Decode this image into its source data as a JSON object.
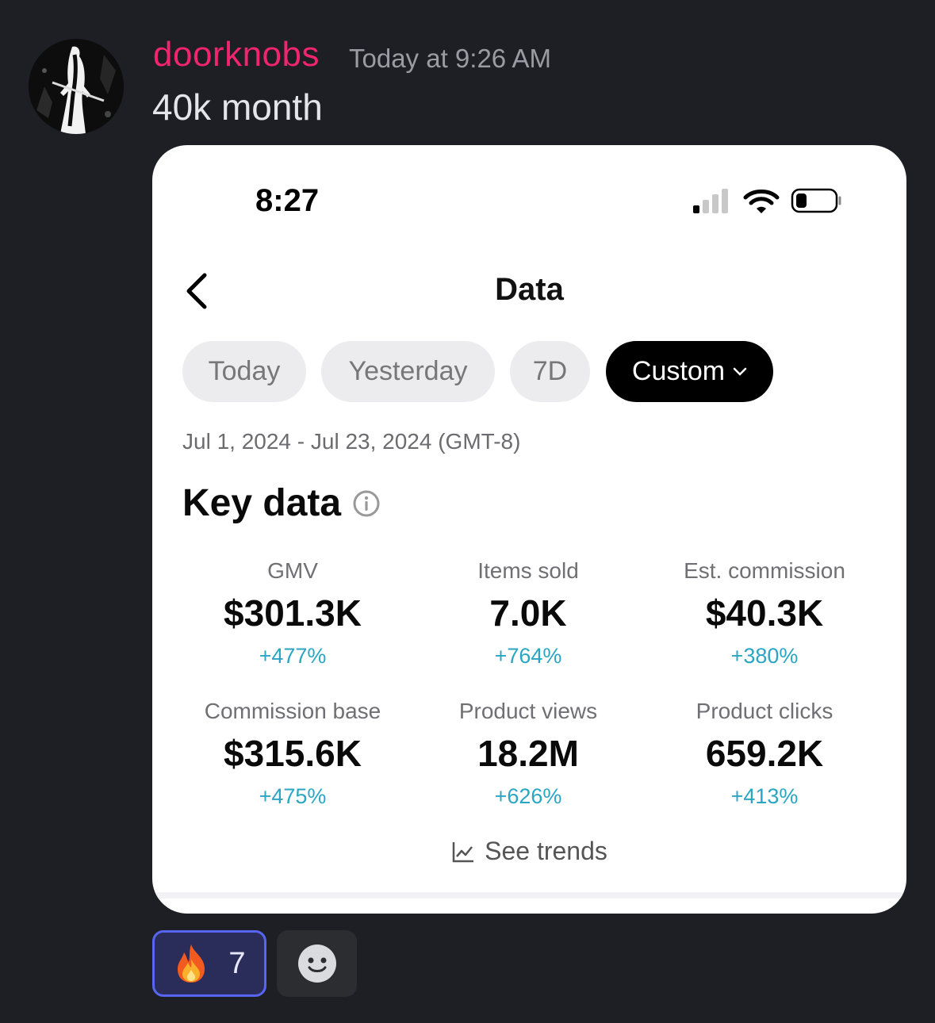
{
  "message": {
    "author": "doorknobs",
    "timestamp": "Today at 9:26 AM",
    "text": "40k month",
    "author_color": "#f0256e"
  },
  "phone": {
    "status_time": "8:27",
    "title": "Data",
    "chips": [
      {
        "label": "Today",
        "active": false
      },
      {
        "label": "Yesterday",
        "active": false
      },
      {
        "label": "7D",
        "active": false
      },
      {
        "label": "Custom",
        "active": true
      }
    ],
    "date_range": "Jul 1, 2024 - Jul 23, 2024 (GMT-8)",
    "section_title": "Key data",
    "metrics": [
      {
        "label": "GMV",
        "value": "$301.3K",
        "change": "+477%"
      },
      {
        "label": "Items sold",
        "value": "7.0K",
        "change": "+764%"
      },
      {
        "label": "Est. commission",
        "value": "$40.3K",
        "change": "+380%"
      },
      {
        "label": "Commission base",
        "value": "$315.6K",
        "change": "+475%"
      },
      {
        "label": "Product views",
        "value": "18.2M",
        "change": "+626%"
      },
      {
        "label": "Product clicks",
        "value": "659.2K",
        "change": "+413%"
      }
    ],
    "see_trends": "See trends",
    "accent_color": "#2aa6c4"
  },
  "reactions": [
    {
      "icon": "fire-emoji-icon",
      "count": "7",
      "selected": true
    }
  ],
  "add_reaction_icon": "smiley-add-reaction-icon"
}
